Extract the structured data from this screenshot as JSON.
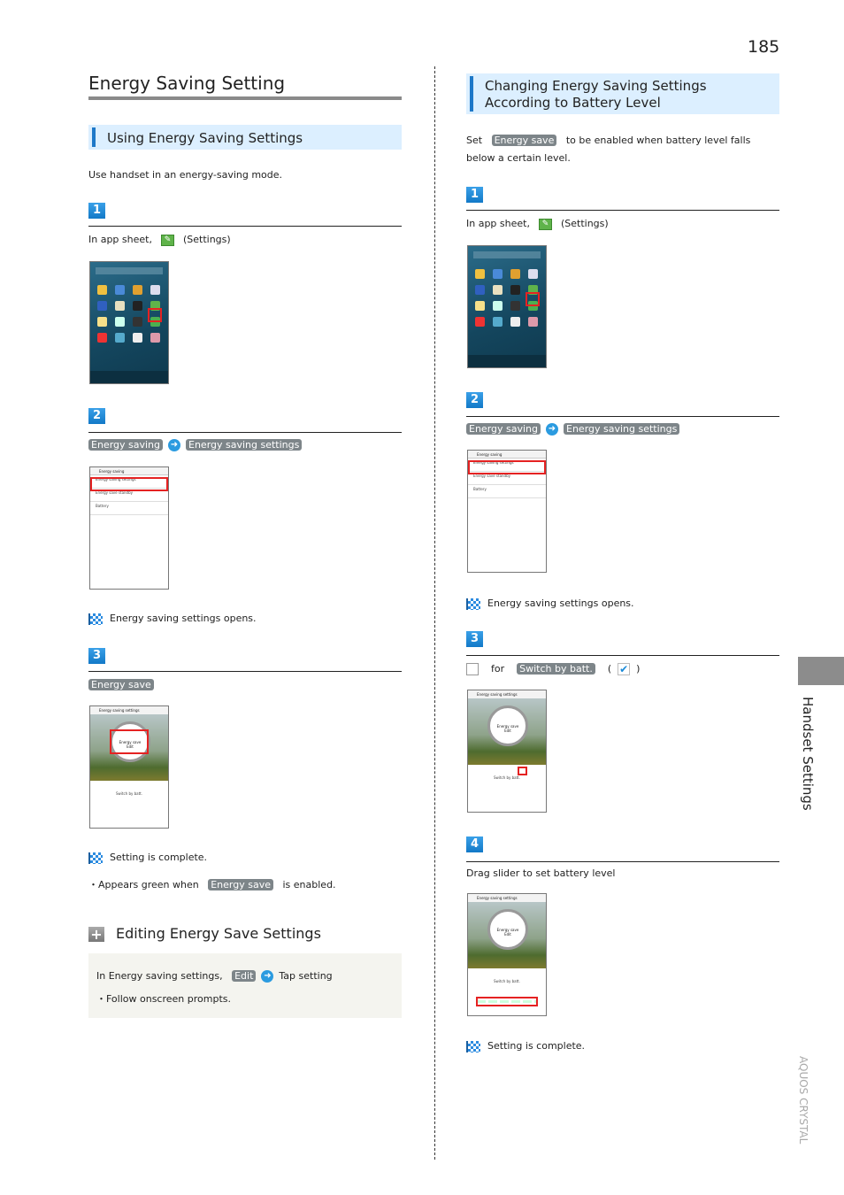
{
  "page_number": "185",
  "side_tab": "Handset Settings",
  "footer_brand": "AQUOS CRYSTAL",
  "left": {
    "title": "Energy Saving Setting",
    "section": "Using Energy Saving Settings",
    "intro": "Use handset in an energy-saving mode.",
    "steps": [
      {
        "num": "1",
        "text_before": "In app sheet,",
        "icon": "settings-icon",
        "text_after": "(Settings)"
      },
      {
        "num": "2",
        "chips": [
          "Energy saving",
          "Energy saving settings"
        ]
      },
      {
        "num": "3",
        "chips": [
          "Energy save"
        ]
      }
    ],
    "result1": "Energy saving settings opens.",
    "result2": "Setting is complete.",
    "note_before": "・Appears green when",
    "note_chip": "Energy save",
    "note_after": "is enabled.",
    "edit": {
      "title": "Editing Energy Save Settings",
      "text_before": "In Energy saving settings,",
      "chip": "Edit",
      "text_after": "Tap setting",
      "note": "・Follow onscreen prompts."
    }
  },
  "right": {
    "section_line1": "Changing Energy Saving Settings",
    "section_line2": "According to Battery Level",
    "intro_before": "Set",
    "intro_chip": "Energy save",
    "intro_after": "to be enabled when battery level falls",
    "intro_line2": "below a certain level.",
    "steps": [
      {
        "num": "1",
        "text_before": "In app sheet,",
        "text_after": "(Settings)"
      },
      {
        "num": "2",
        "chips": [
          "Energy saving",
          "Energy saving settings"
        ]
      },
      {
        "num": "3",
        "text_for": "for",
        "chip": "Switch by batt.",
        "paren_open": "(",
        "paren_close": ")"
      },
      {
        "num": "4",
        "text": "Drag slider to set battery level"
      }
    ],
    "result1": "Energy saving settings opens.",
    "result2": "Setting is complete."
  },
  "screens": {
    "list_title": "Energy saving",
    "list_items": [
      "Energy saving settings",
      "Energy save standby",
      "Battery"
    ],
    "es_title": "Energy saving settings",
    "es_circle": "Energy save",
    "es_edit": "Edit",
    "es_switch": "Switch by batt."
  },
  "colors": {
    "accent": "#1e78c8",
    "header_bg": "#dcefff",
    "chip": "#7d8589",
    "highlight": "#e52222"
  }
}
